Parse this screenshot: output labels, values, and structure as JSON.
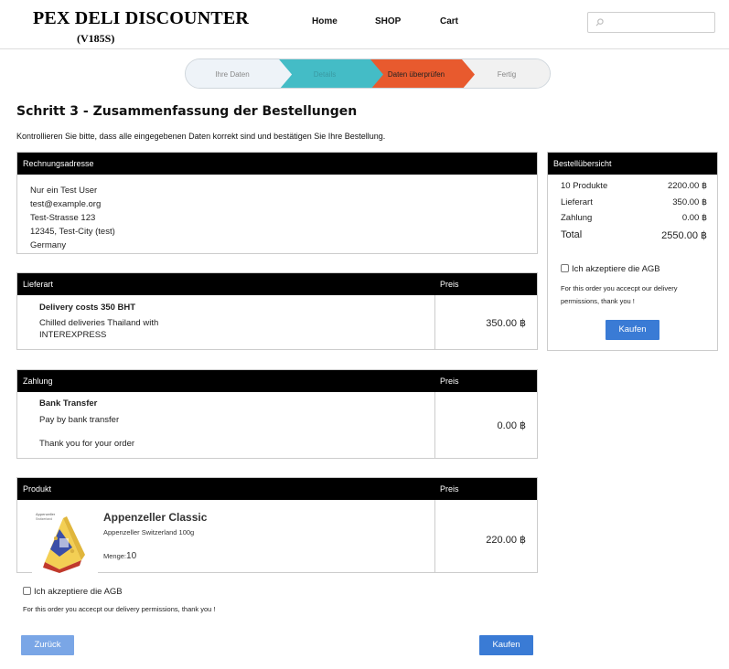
{
  "header": {
    "logo_title": "PEX DELI DISCOUNTER",
    "logo_sub": "(V185S)",
    "nav": {
      "home": "Home",
      "shop": "SHOP",
      "cart": "Cart"
    },
    "search_placeholder": ""
  },
  "steps": [
    {
      "label": "Ihre Daten",
      "state": "done"
    },
    {
      "label": "Details",
      "state": "done"
    },
    {
      "label": "Daten überprüfen",
      "state": "active"
    },
    {
      "label": "Fertig",
      "state": "pending"
    }
  ],
  "page": {
    "title": "Schritt 3 - Zusammenfassung der Bestellungen",
    "intro": "Kontrollieren Sie bitte, dass alle eingegebenen Daten korrekt sind und bestätigen Sie Ihre Bestellung."
  },
  "billing": {
    "heading": "Rechnungsadresse",
    "lines": [
      "Nur ein Test User",
      "test@example.org",
      "Test-Strasse 123",
      "12345, Test-City (test)",
      "Germany"
    ]
  },
  "shipping": {
    "heading": "Lieferart",
    "price_heading": "Preis",
    "name": "Delivery costs 350 BHT",
    "desc_line1": "Chilled deliveries Thailand with",
    "desc_line2": "INTEREXPRESS",
    "price": "350.00 ฿"
  },
  "payment": {
    "heading": "Zahlung",
    "price_heading": "Preis",
    "name": "Bank Transfer",
    "desc": "Pay by bank transfer",
    "thanks": "Thank you for your order",
    "price": "0.00 ฿"
  },
  "product": {
    "heading": "Produkt",
    "price_heading": "Preis",
    "name": "Appenzeller Classic",
    "desc": "Appenzeller Switzerland 100g",
    "qty_label": "Menge:",
    "qty": "10",
    "price": "220.00 ฿"
  },
  "summary": {
    "heading": "Bestellübersicht",
    "rows": [
      {
        "label": "10 Produkte",
        "value": "2200.00 ฿"
      },
      {
        "label": "Lieferart",
        "value": "350.00 ฿"
      },
      {
        "label": "Zahlung",
        "value": "0.00 ฿"
      }
    ],
    "total_label": "Total",
    "total_value": "2550.00 ฿",
    "agb_label": "Ich akzeptiere die AGB",
    "note_line1": "For this order you accecpt our delivery",
    "note_line2": "permissions, thank you !",
    "buy_label": "Kaufen"
  },
  "footer": {
    "agb_label": "Ich akzeptiere die AGB",
    "note": "For this order you accecpt our delivery permissions, thank you !",
    "back_label": "Zurück",
    "buy_label": "Kaufen"
  },
  "colors": {
    "step_done": "#44bcc6",
    "step_active": "#e85a2e",
    "button": "#3a7bd5"
  }
}
